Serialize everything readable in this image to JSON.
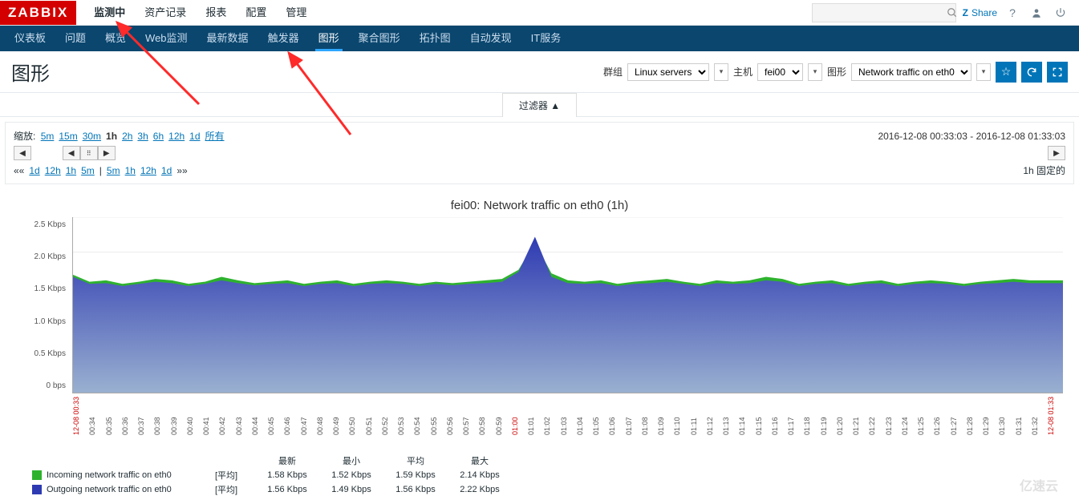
{
  "logo": "ZABBIX",
  "top_nav": [
    "监测中",
    "资产记录",
    "报表",
    "配置",
    "管理"
  ],
  "top_nav_active": 0,
  "header_right": {
    "share": "Share"
  },
  "sub_nav": [
    "仪表板",
    "问题",
    "概览",
    "Web监测",
    "最新数据",
    "触发器",
    "图形",
    "聚合图形",
    "拓扑图",
    "自动发现",
    "IT服务"
  ],
  "sub_nav_active": 6,
  "page_title": "图形",
  "selectors": {
    "group_label": "群组",
    "group_value": "Linux servers",
    "host_label": "主机",
    "host_value": "fei00",
    "graph_label": "图形",
    "graph_value": "Network traffic on eth0"
  },
  "filter_tab": "过滤器 ▲",
  "zoom_label": "缩放:",
  "zoom_levels": [
    "5m",
    "15m",
    "30m",
    "1h",
    "2h",
    "3h",
    "6h",
    "12h",
    "1d",
    "所有"
  ],
  "zoom_current": "1h",
  "time_from": "2016-12-08 00:33:03",
  "time_to": "2016-12-08 01:33:03",
  "quick_left": [
    "««",
    "1d",
    "12h",
    "1h",
    "5m"
  ],
  "quick_sep": "|",
  "quick_right": [
    "5m",
    "1h",
    "12h",
    "1d",
    "»»"
  ],
  "fixed_label": "1h  固定的",
  "chart_data": {
    "type": "area",
    "title": "fei00: Network traffic on eth0 (1h)",
    "ylabel": "",
    "xlabel": "",
    "y_ticks": [
      "2.5 Kbps",
      "2.0 Kbps",
      "1.5 Kbps",
      "1.0 Kbps",
      "0.5 Kbps",
      "0 bps"
    ],
    "ylim": [
      0,
      2.5
    ],
    "x_ticks": [
      "12-08 00:33",
      "00:34",
      "00:35",
      "00:36",
      "00:37",
      "00:38",
      "00:39",
      "00:40",
      "00:41",
      "00:42",
      "00:43",
      "00:44",
      "00:45",
      "00:46",
      "00:47",
      "00:48",
      "00:49",
      "00:50",
      "00:51",
      "00:52",
      "00:53",
      "00:54",
      "00:55",
      "00:56",
      "00:57",
      "00:58",
      "00:59",
      "01:00",
      "01:01",
      "01:02",
      "01:03",
      "01:04",
      "01:05",
      "01:06",
      "01:07",
      "01:08",
      "01:09",
      "01:10",
      "01:11",
      "01:12",
      "01:13",
      "01:14",
      "01:15",
      "01:16",
      "01:17",
      "01:18",
      "01:19",
      "01:20",
      "01:21",
      "01:22",
      "01:23",
      "01:24",
      "01:25",
      "01:26",
      "01:27",
      "01:28",
      "01:29",
      "01:30",
      "01:31",
      "01:32",
      "12-08 01:33"
    ],
    "x_red": [
      0,
      27,
      60
    ],
    "series": [
      {
        "name": "Incoming network traffic on eth0",
        "color": "#2eb22e",
        "agg": "[平均]",
        "last": "1.58 Kbps",
        "min": "1.52 Kbps",
        "avg": "1.59 Kbps",
        "max": "2.14 Kbps",
        "values": [
          1.68,
          1.58,
          1.6,
          1.55,
          1.58,
          1.62,
          1.6,
          1.55,
          1.58,
          1.65,
          1.6,
          1.56,
          1.58,
          1.6,
          1.55,
          1.58,
          1.6,
          1.55,
          1.58,
          1.6,
          1.58,
          1.55,
          1.58,
          1.56,
          1.58,
          1.6,
          1.62,
          1.75,
          2.14,
          1.7,
          1.6,
          1.58,
          1.6,
          1.55,
          1.58,
          1.6,
          1.62,
          1.58,
          1.55,
          1.6,
          1.58,
          1.6,
          1.65,
          1.62,
          1.55,
          1.58,
          1.6,
          1.55,
          1.58,
          1.6,
          1.55,
          1.58,
          1.6,
          1.58,
          1.55,
          1.58,
          1.6,
          1.62,
          1.6,
          1.6,
          1.6
        ]
      },
      {
        "name": "Outgoing network traffic on eth0",
        "color": "#2e3ab2",
        "agg": "[平均]",
        "last": "1.56 Kbps",
        "min": "1.49 Kbps",
        "avg": "1.56 Kbps",
        "max": "2.22 Kbps",
        "values": [
          1.65,
          1.55,
          1.56,
          1.52,
          1.55,
          1.58,
          1.56,
          1.52,
          1.55,
          1.6,
          1.56,
          1.53,
          1.55,
          1.56,
          1.52,
          1.55,
          1.56,
          1.52,
          1.55,
          1.56,
          1.55,
          1.52,
          1.55,
          1.53,
          1.55,
          1.56,
          1.58,
          1.72,
          2.22,
          1.65,
          1.56,
          1.55,
          1.56,
          1.52,
          1.55,
          1.56,
          1.58,
          1.55,
          1.52,
          1.56,
          1.55,
          1.56,
          1.6,
          1.58,
          1.52,
          1.55,
          1.56,
          1.52,
          1.55,
          1.56,
          1.52,
          1.55,
          1.56,
          1.55,
          1.52,
          1.55,
          1.56,
          1.58,
          1.56,
          1.56,
          1.56
        ]
      }
    ],
    "legend_headers": [
      "最新",
      "最小",
      "平均",
      "最大"
    ]
  },
  "watermark": "亿速云"
}
